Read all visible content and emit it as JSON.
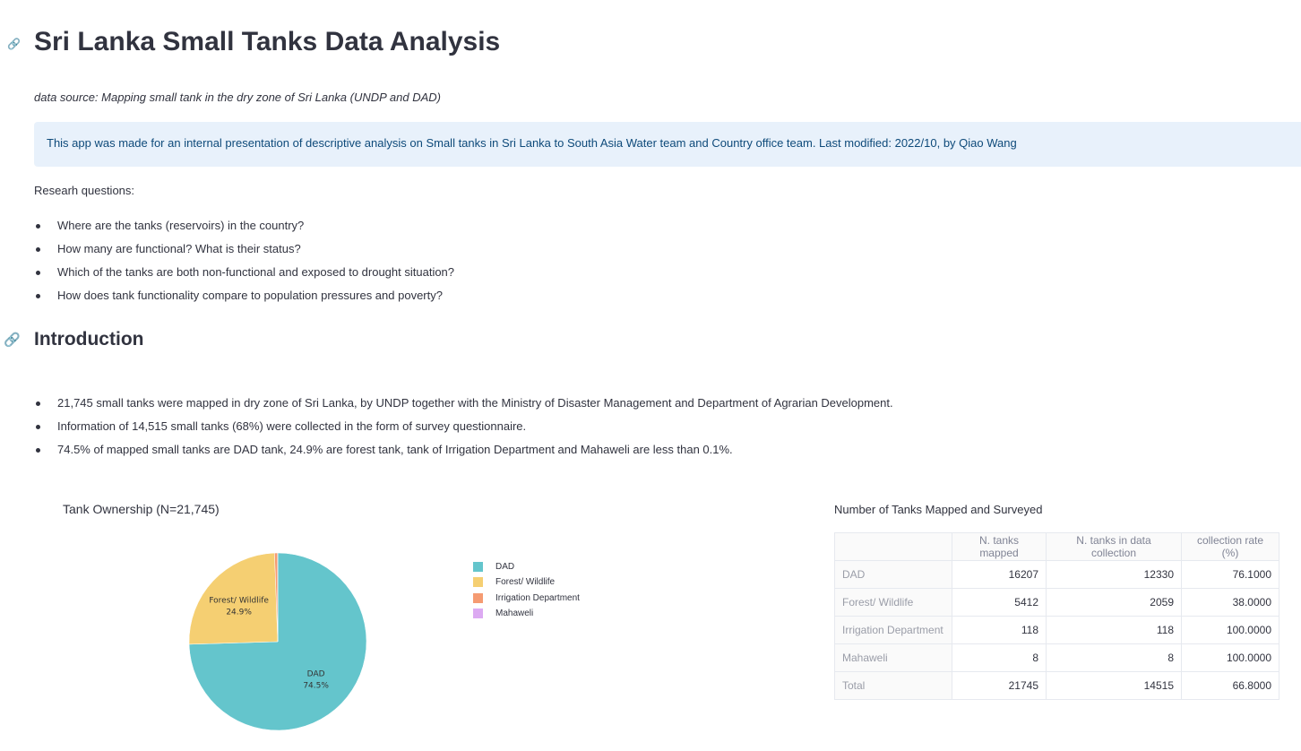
{
  "title": "Sri Lanka Small Tanks Data Analysis",
  "data_source": "data source: Mapping small tank in the dry zone of Sri Lanka (UNDP and DAD)",
  "info": "This app was made for an internal presentation of descriptive analysis on Small tanks in Sri Lanka to South Asia Water team and Country office team. Last modified: 2022/10, by Qiao Wang",
  "research_label": "Researh questions:",
  "research_questions": [
    "Where are the tanks (reservoirs) in the country?",
    "How many are functional? What is their status?",
    "Which of the tanks are both non-functional and exposed to drought situation?",
    "How does tank functionality compare to population pressures and poverty?"
  ],
  "introduction": {
    "heading": "Introduction",
    "bullets": [
      "21,745 small tanks were mapped in dry zone of Sri Lanka, by UNDP together with the Ministry of Disaster Management and Department of Agrarian Development.",
      "Information of 14,515 small tanks (68%) were collected in the form of survey questionnaire.",
      "74.5% of mapped small tanks are DAD tank, 24.9% are forest tank, tank of Irrigation Department and Mahaweli are less than 0.1%."
    ]
  },
  "link_icon": "link-icon",
  "chart_data": {
    "type": "pie",
    "title": "Tank Ownership (N=21,745)",
    "categories": [
      "DAD",
      "Forest/ Wildlife",
      "Irrigation Department",
      "Mahaweli"
    ],
    "values": [
      16207,
      5412,
      118,
      8
    ],
    "labels": [
      {
        "name": "DAD",
        "pct": "74.5%"
      },
      {
        "name": "Forest/ Wildlife",
        "pct": "24.9%"
      }
    ],
    "colors": [
      "#64c5cc",
      "#f5cf72",
      "#f59b72",
      "#dcaaf2"
    ],
    "legend_position": "right"
  },
  "table": {
    "title": "Number of Tanks Mapped and Surveyed",
    "columns": [
      "",
      "N. tanks mapped",
      "N. tanks in data collection",
      "collection rate (%)"
    ],
    "rows": [
      [
        "DAD",
        "16207",
        "12330",
        "76.1000"
      ],
      [
        "Forest/ Wildlife",
        "5412",
        "2059",
        "38.0000"
      ],
      [
        "Irrigation Department",
        "118",
        "118",
        "100.0000"
      ],
      [
        "Mahaweli",
        "8",
        "8",
        "100.0000"
      ],
      [
        "Total",
        "21745",
        "14515",
        "66.8000"
      ]
    ]
  }
}
